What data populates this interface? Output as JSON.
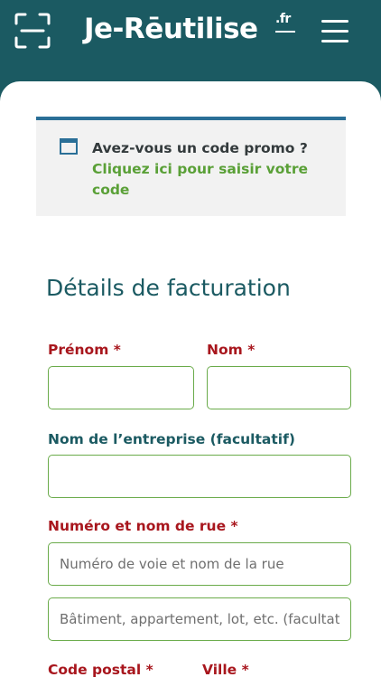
{
  "header": {
    "logo_text": "Je-Rēutilise",
    "logo_tld": ".fr",
    "scan_icon": "scan-frame-icon",
    "menu_icon": "hamburger-menu-icon"
  },
  "promo": {
    "question": "Avez-vous un code promo ?",
    "link": "Cliquez ici pour saisir votre code",
    "icon": "window-icon"
  },
  "billing": {
    "title": "Détails de facturation",
    "first_name_label": "Prénom",
    "last_name_label": "Nom",
    "company_label": "Nom de l’entreprise (facultatif)",
    "street_label": "Numéro et nom de rue",
    "street_placeholder": "Numéro de voie et nom de la rue",
    "street2_placeholder": "Bâtiment, appartement, lot, etc. (facultatif)",
    "postcode_label": "Code postal",
    "city_label": "Ville",
    "required_mark": "*"
  },
  "colors": {
    "brand": "#1b5a62",
    "required": "#a8161d",
    "link": "#5aa037",
    "field_border": "#6aab4a",
    "promo_border": "#2a6f97"
  }
}
